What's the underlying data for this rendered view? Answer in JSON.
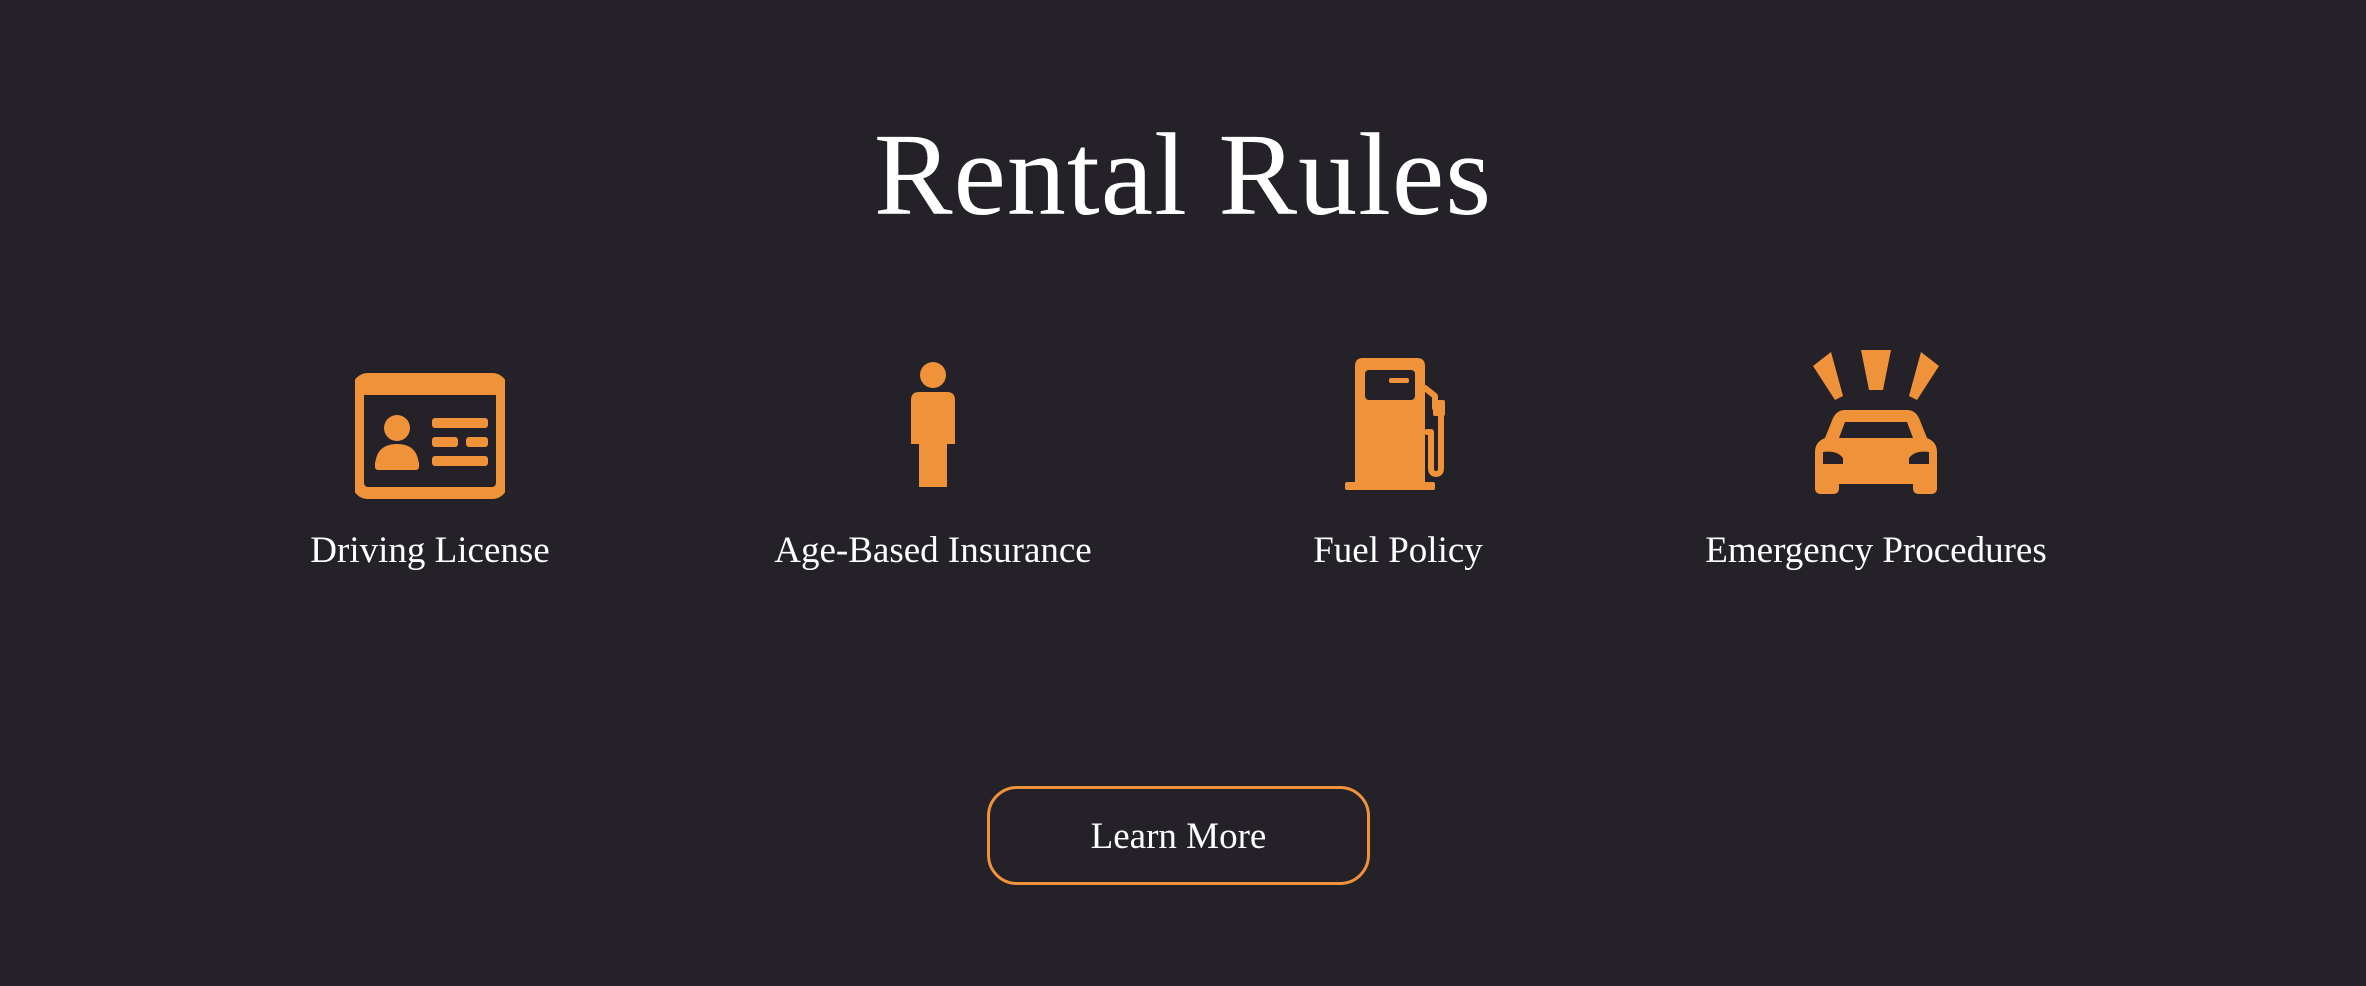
{
  "header": {
    "title": "Rental Rules"
  },
  "features": [
    {
      "label": "Driving License",
      "icon": "id-card-icon"
    },
    {
      "label": "Age-Based Insurance",
      "icon": "person-icon"
    },
    {
      "label": "Fuel Policy",
      "icon": "gas-pump-icon"
    },
    {
      "label": "Emergency Procedures",
      "icon": "car-crash-icon"
    }
  ],
  "cta": {
    "label": "Learn More"
  },
  "colors": {
    "background": "#242128",
    "accent": "#f0923a",
    "text": "#ffffff"
  }
}
